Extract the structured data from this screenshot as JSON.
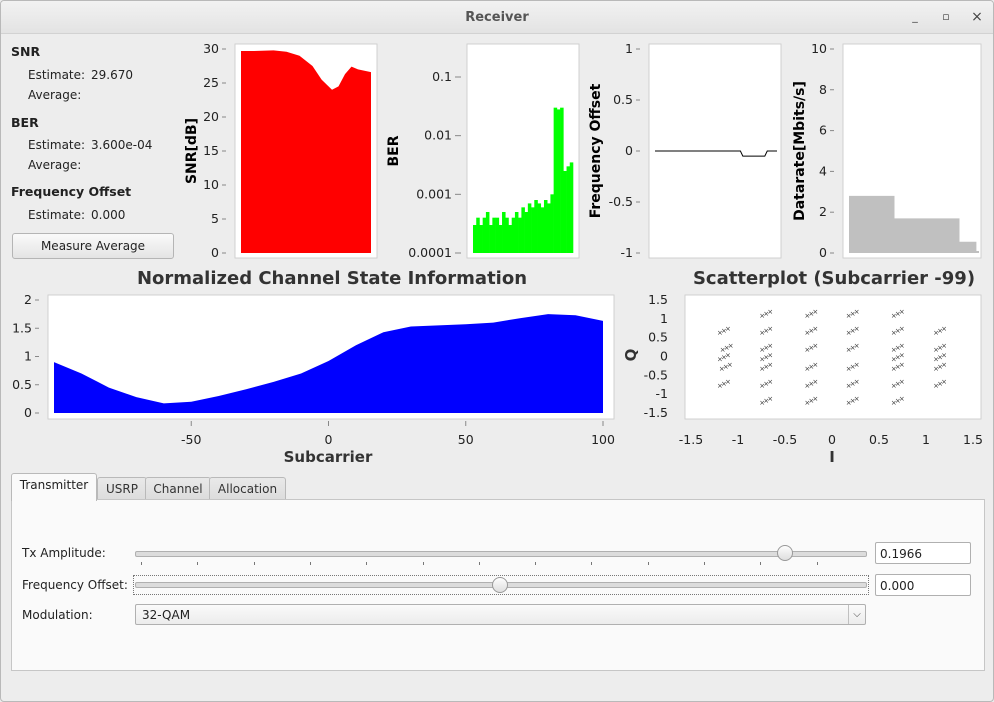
{
  "window": {
    "title": "Receiver",
    "minimize": "_",
    "maximize": "▫",
    "close": "×"
  },
  "info": {
    "snr_heading": "SNR",
    "snr_estimate_label": "Estimate:",
    "snr_estimate": "29.670",
    "snr_average_label": "Average:",
    "ber_heading": "BER",
    "ber_estimate_label": "Estimate:",
    "ber_estimate": "3.600e-04",
    "ber_average_label": "Average:",
    "fo_heading": "Frequency Offset",
    "fo_estimate_label": "Estimate:",
    "fo_estimate": "0.000",
    "measure_button": "Measure Average"
  },
  "colors": {
    "snr": "#ff0000",
    "ber": "#00ff00",
    "csi": "#0000ff",
    "datarate": "#c0c0c0"
  },
  "charts": {
    "snr_ylabel": "SNR[dB]",
    "snr_ticks": [
      "30",
      "25",
      "20",
      "15",
      "10",
      "5",
      "0"
    ],
    "ber_ylabel": "BER",
    "ber_ticks": [
      "0.1",
      "0.01",
      "0.001",
      "0.0001"
    ],
    "fo_ylabel": "Frequency Offset",
    "fo_ticks": [
      "1",
      "0.5",
      "0",
      "-0.5",
      "-1"
    ],
    "dr_ylabel": "Datarate[Mbits/s]",
    "dr_ticks": [
      "10",
      "8",
      "6",
      "4",
      "2",
      "0"
    ],
    "csi_title": "Normalized Channel State Information",
    "csi_xlabel": "Subcarrier",
    "csi_yticks": [
      "2",
      "1.5",
      "1",
      "0.5",
      "0"
    ],
    "csi_xticks": [
      "-50",
      "0",
      "50",
      "100"
    ],
    "scatter_title": "Scatterplot (Subcarrier -99)",
    "scatter_xlabel": "I",
    "scatter_ylabel": "Q",
    "scatter_yticks": [
      "1.5",
      "1",
      "0.5",
      "0",
      "-0.5",
      "-1",
      "-1.5"
    ],
    "scatter_xticks": [
      "-1.5",
      "-1",
      "-0.5",
      "0",
      "0.5",
      "1",
      "1.5"
    ]
  },
  "chart_data": [
    {
      "type": "area",
      "ylabel": "SNR[dB]",
      "ylim": [
        0,
        30
      ],
      "x": [
        0,
        0.1,
        0.25,
        0.35,
        0.45,
        0.55,
        0.62,
        0.7,
        0.75,
        0.8,
        0.85,
        0.9,
        1.0
      ],
      "values": [
        29.7,
        29.7,
        29.8,
        29.6,
        29.0,
        27.5,
        25.5,
        24.0,
        24.5,
        26.3,
        27.4,
        27.0,
        26.6
      ]
    },
    {
      "type": "bar",
      "ylabel": "BER",
      "log_scale": true,
      "ylim": [
        0.0001,
        0.3
      ],
      "values": [
        0.0003,
        0.0004,
        0.0003,
        0.0004,
        0.0005,
        0.0003,
        0.0004,
        0.0004,
        0.0003,
        0.0005,
        0.0004,
        0.0003,
        0.0004,
        0.0005,
        0.0004,
        0.0006,
        0.0005,
        0.0007,
        0.0006,
        0.0008,
        0.0007,
        0.0006,
        0.0008,
        0.0007,
        0.001,
        0.03,
        0.028,
        0.03,
        0.0025,
        0.003,
        0.0035
      ]
    },
    {
      "type": "line",
      "ylabel": "Frequency Offset",
      "ylim": [
        -1,
        1
      ],
      "x": [
        0,
        0.7,
        0.72,
        0.8,
        0.82,
        0.9,
        0.92,
        1.0
      ],
      "values": [
        0,
        0,
        -0.05,
        -0.05,
        -0.05,
        -0.05,
        0,
        0
      ]
    },
    {
      "type": "area",
      "ylabel": "Datarate[Mbits/s]",
      "ylim": [
        0,
        10
      ],
      "x": [
        0,
        0.35,
        0.35,
        0.85,
        0.85,
        0.98,
        0.98,
        1.0
      ],
      "values": [
        2.8,
        2.8,
        1.7,
        1.7,
        0.55,
        0.55,
        0.1,
        0.1
      ]
    },
    {
      "type": "bar",
      "title": "Normalized Channel State Information",
      "xlabel": "Subcarrier",
      "xlim": [
        -100,
        100
      ],
      "ylim": [
        0,
        2
      ],
      "x": [
        -100,
        -90,
        -80,
        -70,
        -60,
        -50,
        -40,
        -30,
        -20,
        -10,
        0,
        10,
        20,
        30,
        40,
        50,
        60,
        70,
        80,
        90,
        100
      ],
      "values": [
        0.9,
        0.7,
        0.45,
        0.28,
        0.17,
        0.2,
        0.3,
        0.42,
        0.55,
        0.7,
        0.92,
        1.2,
        1.43,
        1.53,
        1.55,
        1.57,
        1.6,
        1.68,
        1.75,
        1.73,
        1.63
      ]
    },
    {
      "type": "scatter",
      "title": "Scatterplot (Subcarrier -99)",
      "xlabel": "I",
      "ylabel": "Q",
      "xlim": [
        -1.5,
        1.5
      ],
      "ylim": [
        -1.5,
        1.5
      ],
      "points": [
        [
          -1.15,
          0.7
        ],
        [
          -1.12,
          0.25
        ],
        [
          -1.15,
          0.0
        ],
        [
          -1.13,
          -0.25
        ],
        [
          -1.15,
          -0.7
        ],
        [
          -0.7,
          1.15
        ],
        [
          -0.7,
          0.7
        ],
        [
          -0.7,
          0.25
        ],
        [
          -0.7,
          0.0
        ],
        [
          -0.7,
          -0.25
        ],
        [
          -0.7,
          -0.7
        ],
        [
          -0.7,
          -1.15
        ],
        [
          -0.22,
          1.15
        ],
        [
          -0.22,
          0.7
        ],
        [
          -0.22,
          0.25
        ],
        [
          -0.22,
          -0.25
        ],
        [
          -0.22,
          -0.7
        ],
        [
          -0.22,
          -1.15
        ],
        [
          0.22,
          1.15
        ],
        [
          0.22,
          0.7
        ],
        [
          0.22,
          0.25
        ],
        [
          0.22,
          -0.25
        ],
        [
          0.22,
          -0.7
        ],
        [
          0.22,
          -1.15
        ],
        [
          0.7,
          1.15
        ],
        [
          0.7,
          0.7
        ],
        [
          0.7,
          0.25
        ],
        [
          0.7,
          0.0
        ],
        [
          0.7,
          -0.25
        ],
        [
          0.7,
          -0.7
        ],
        [
          0.7,
          -1.15
        ],
        [
          1.15,
          0.7
        ],
        [
          1.15,
          0.25
        ],
        [
          1.15,
          0.0
        ],
        [
          1.15,
          -0.25
        ],
        [
          1.15,
          -0.7
        ]
      ]
    }
  ],
  "tabs": [
    {
      "label": "Transmitter",
      "active": true
    },
    {
      "label": "USRP"
    },
    {
      "label": "Channel"
    },
    {
      "label": "Allocation"
    }
  ],
  "controls": {
    "tx_amp_label": "Tx Amplitude:",
    "tx_amp_value": "0.1966",
    "tx_amp_fraction": 0.89,
    "fo_label": "Frequency Offset:",
    "fo_value": "0.000",
    "fo_fraction": 0.5,
    "mod_label": "Modulation:",
    "mod_value": "32-QAM"
  }
}
